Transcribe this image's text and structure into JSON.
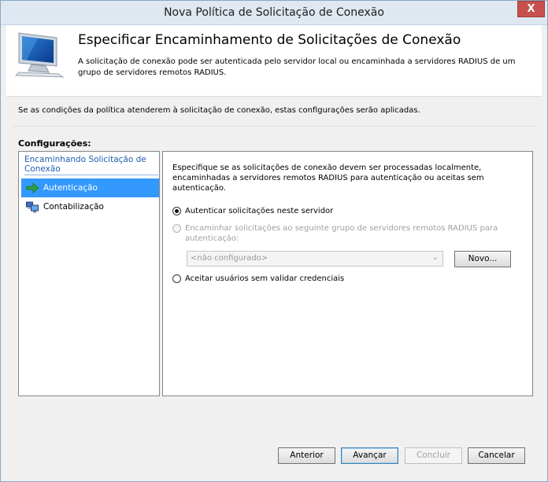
{
  "window": {
    "title": "Nova Política de Solicitação de Conexão",
    "close_label": "X"
  },
  "header": {
    "title": "Especificar Encaminhamento de Solicitações de Conexão",
    "description": "A solicitação de conexão pode ser autenticada pelo servidor local ou encaminhada a servidores RADIUS de um grupo de servidores remotos RADIUS."
  },
  "intro_text": "Se as condições da política atenderem à solicitação de conexão, estas configurações serão aplicadas.",
  "settings_label": "Configurações:",
  "nav": {
    "group_label": "Encaminhando Solicitação de Conexão",
    "items": [
      {
        "label": "Autenticação",
        "icon": "green-arrow-icon",
        "selected": true
      },
      {
        "label": "Contabilização",
        "icon": "server-computers-icon",
        "selected": false
      }
    ]
  },
  "panel": {
    "description": "Especifique se as solicitações de conexão devem ser processadas localmente, encaminhadas a servidores remotos RADIUS para autenticação ou aceitas sem autenticação.",
    "options": [
      {
        "label": "Autenticar solicitações neste servidor",
        "checked": true,
        "enabled": true
      },
      {
        "label": "Encaminhar solicitações ao seguinte grupo de servidores remotos RADIUS para autenticação:",
        "checked": false,
        "enabled": false
      },
      {
        "label": "Aceitar usuários sem validar credenciais",
        "checked": false,
        "enabled": true
      }
    ],
    "server_group_value": "<não configurado>",
    "new_button_label": "Novo..."
  },
  "footer": {
    "back_label": "Anterior",
    "next_label": "Avançar",
    "finish_label": "Concluir",
    "cancel_label": "Cancelar"
  }
}
